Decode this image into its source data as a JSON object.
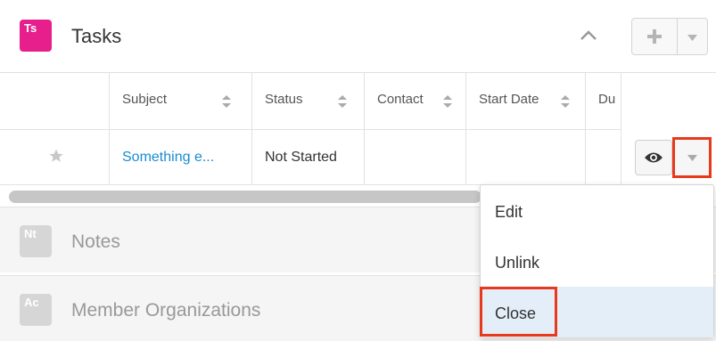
{
  "tasks_panel": {
    "badge": "Ts",
    "title": "Tasks",
    "collapse_icon": "chevron-up-icon",
    "add_icon": "plus-icon",
    "more_icon": "caret-down-icon"
  },
  "table": {
    "columns": [
      "Subject",
      "Status",
      "Contact",
      "Start Date",
      "Du"
    ],
    "rows": [
      {
        "favorite_icon": "star-icon",
        "subject": "Something e...",
        "status": "Not Started"
      }
    ],
    "row_actions": {
      "preview_icon": "eye-icon",
      "dropdown_icon": "caret-down-icon"
    }
  },
  "panels": [
    {
      "badge": "Nt",
      "label": "Notes"
    },
    {
      "badge": "Ac",
      "label": "Member Organizations"
    }
  ],
  "menu": {
    "items": [
      "Edit",
      "Unlink",
      "Close"
    ],
    "selected": "Close"
  },
  "colors": {
    "tasks_badge": "#e61f8c",
    "link": "#1a8ccf",
    "highlight": "#e8391d",
    "menu_selected": "#e4eef9"
  }
}
